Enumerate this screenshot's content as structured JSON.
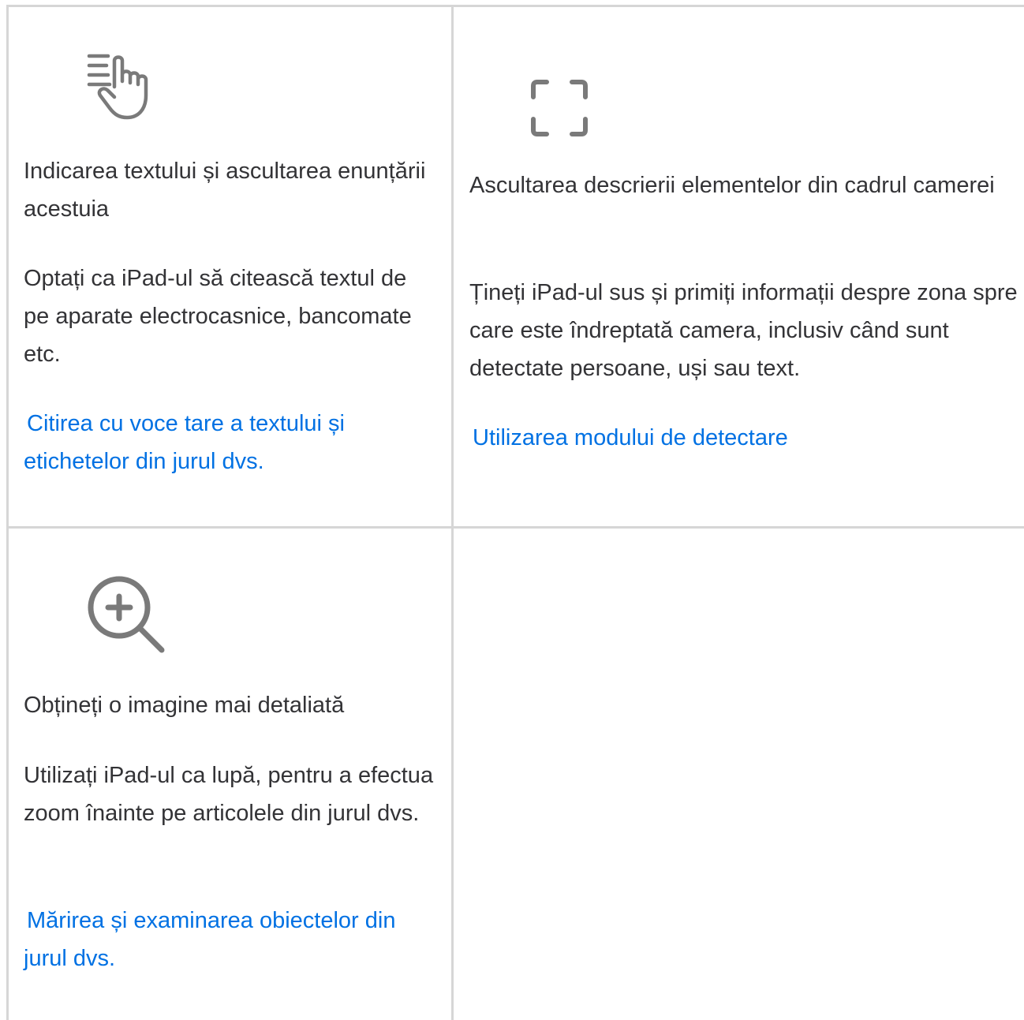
{
  "cards": [
    {
      "icon": "pointing-hand-text-icon",
      "title": "Indicarea textului și ascultarea enunțării acestuia",
      "description": "Optați ca iPad-ul să citească textul de pe aparate electrocasnice, bancomate etc.",
      "link": "Citirea cu voce tare a textului și etichetelor din jurul dvs."
    },
    {
      "icon": "viewfinder-icon",
      "title": "Ascultarea descrierii elementelor din cadrul camerei",
      "description": "Țineți iPad-ul sus și primiți informații despre zona spre care este îndreptată camera, inclusiv când sunt detectate persoane, uși sau text.",
      "link": "Utilizarea modului de detectare"
    },
    {
      "icon": "magnifier-plus-icon",
      "title": "Obțineți o imagine mai detaliată",
      "description": "Utilizați iPad-ul ca lupă, pentru a efectua zoom înainte pe articolele din jurul dvs.",
      "link": "Mărirea și examinarea obiectelor din jurul dvs."
    }
  ],
  "colors": {
    "text": "#333336",
    "link": "#0071e3",
    "icon": "#7a7a7a",
    "divider": "#d6d6d6"
  }
}
